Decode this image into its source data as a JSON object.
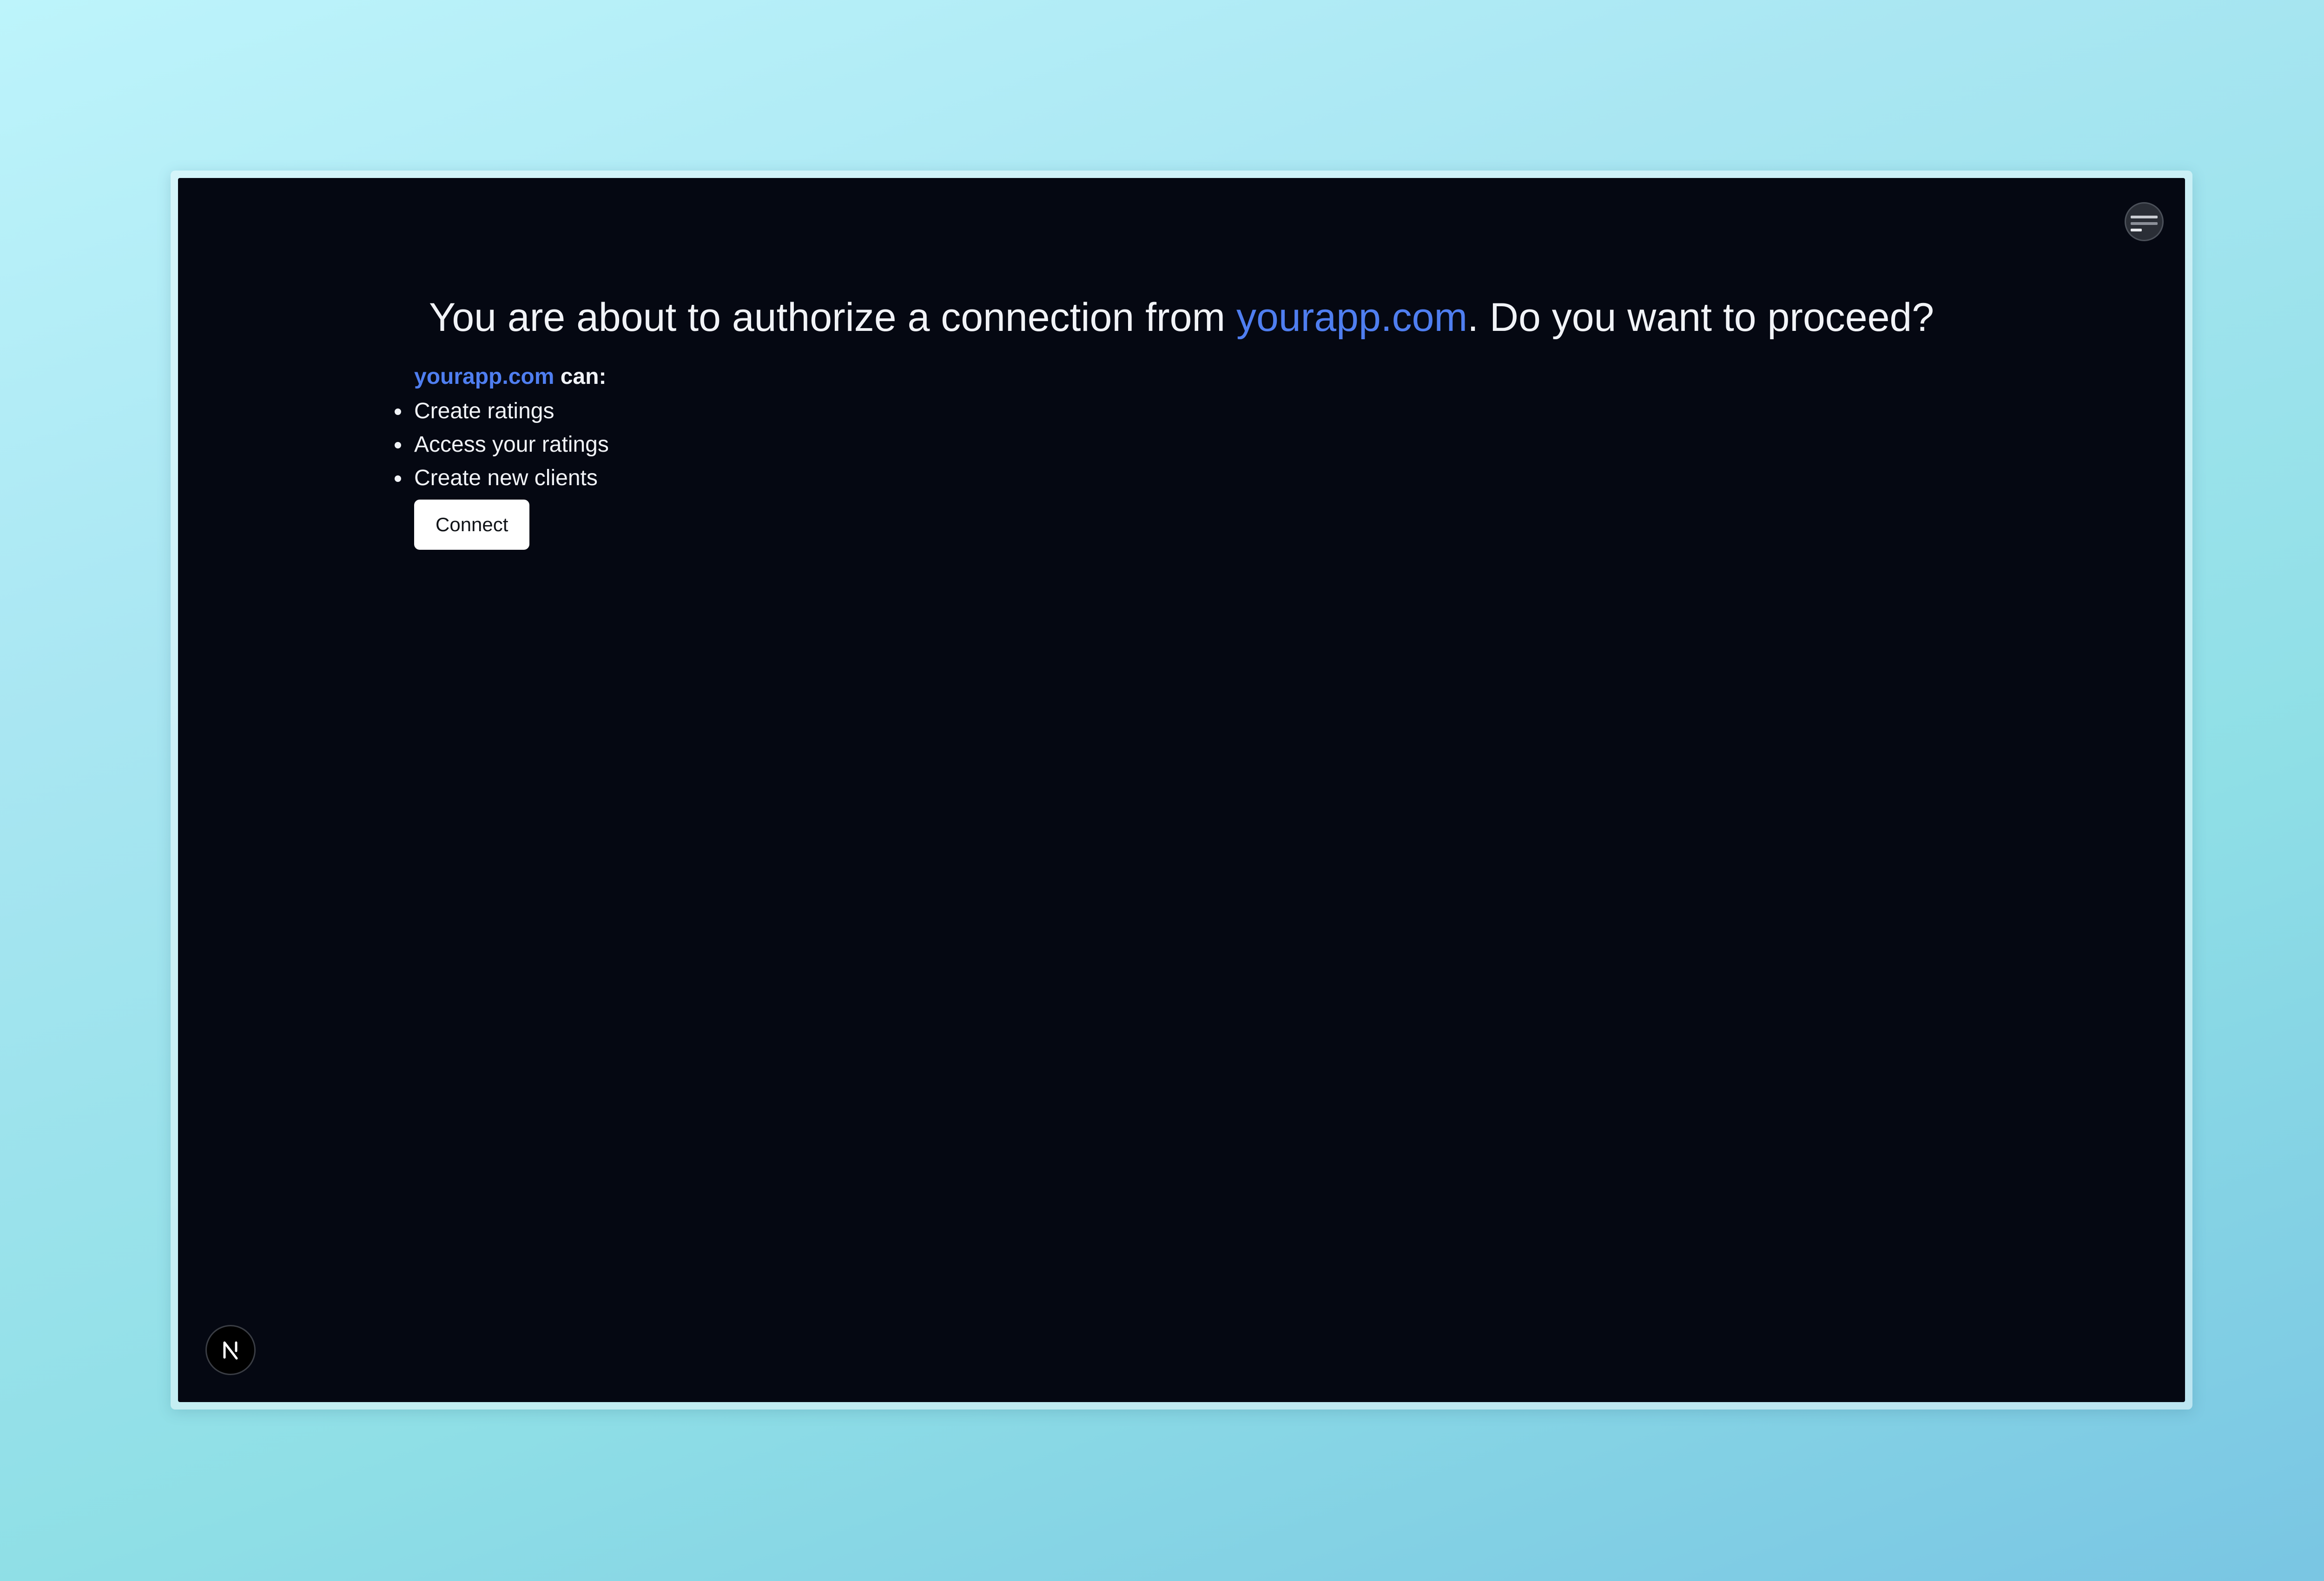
{
  "headline": {
    "prefix": "You are about to authorize a connection from ",
    "domain": "yourapp.com",
    "suffix": ". Do you want to proceed?"
  },
  "permissions": {
    "domain": "yourapp.com",
    "can_label": "can:",
    "items": [
      {
        "label": "Create ratings"
      },
      {
        "label": "Access your ratings"
      },
      {
        "label": "Create new clients"
      }
    ]
  },
  "connect_button": {
    "label": "Connect"
  },
  "dev_badge": {
    "letter": "N"
  },
  "colors": {
    "page_background": "#050812",
    "link_accent": "#4f7ef0",
    "text": "#f1f3f7",
    "button_background": "#ffffff"
  },
  "icons": {
    "avatar": "user-avatar-icon",
    "dev_badge": "nextjs-logo-icon"
  }
}
